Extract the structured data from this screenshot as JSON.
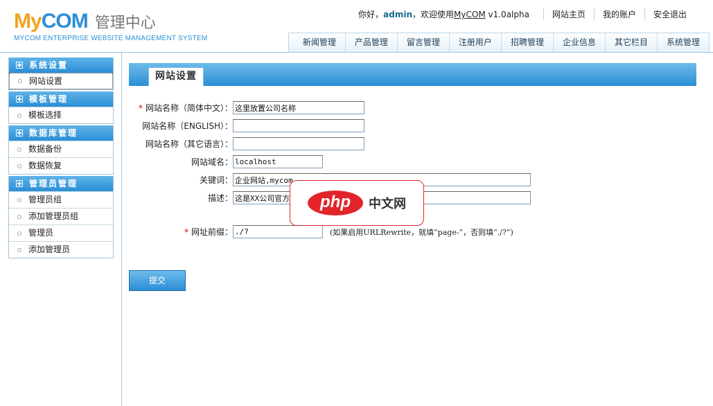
{
  "logo": {
    "my": "My",
    "com": "COM",
    "cn_title": "管理中心",
    "subtitle": "MYCOM ENTERPRISE WEBSITE MANAGEMENT SYSTEM"
  },
  "topbar": {
    "greet_prefix": "你好，",
    "username": "admin",
    "greet_mid": "，欢迎使用",
    "product": "MyCOM",
    "version": " v1.0alpha",
    "links": [
      "网站主页",
      "我的账户",
      "安全退出"
    ]
  },
  "mainnav": [
    "新闻管理",
    "产品管理",
    "留言管理",
    "注册用户",
    "招聘管理",
    "企业信息",
    "其它栏目",
    "系统管理"
  ],
  "sidebar": {
    "groups": [
      {
        "title": "系统设置",
        "items": [
          "网站设置"
        ]
      },
      {
        "title": "模板管理",
        "items": [
          "模板选择"
        ]
      },
      {
        "title": "数据库管理",
        "items": [
          "数据备份",
          "数据恢复"
        ]
      },
      {
        "title": "管理员管理",
        "items": [
          "管理员组",
          "添加管理员组",
          "管理员",
          "添加管理员"
        ]
      }
    ]
  },
  "content": {
    "tab_title": "网站设置",
    "fields": {
      "name_cn": {
        "label": "网站名称（简体中文）：",
        "value": "这里放置公司名称"
      },
      "name_en": {
        "label": "网站名称（ENGLISH）：",
        "value": ""
      },
      "name_other": {
        "label": "网站名称（其它语言）：",
        "value": ""
      },
      "domain": {
        "label": "网站域名：",
        "value": "localhost"
      },
      "keywords": {
        "label": "关键词：",
        "value": "企业网站,mycom"
      },
      "description": {
        "label": "描述：",
        "value": "这是XX公司官方"
      },
      "prefix": {
        "label": "网址前缀：",
        "value": "./?",
        "hint": "(如果启用URLRewrite，就填“page-”，否则填“./?”)"
      }
    },
    "required_mark": "*",
    "submit_label": "提交"
  },
  "watermark": {
    "php": "php",
    "cn": "中文网"
  }
}
